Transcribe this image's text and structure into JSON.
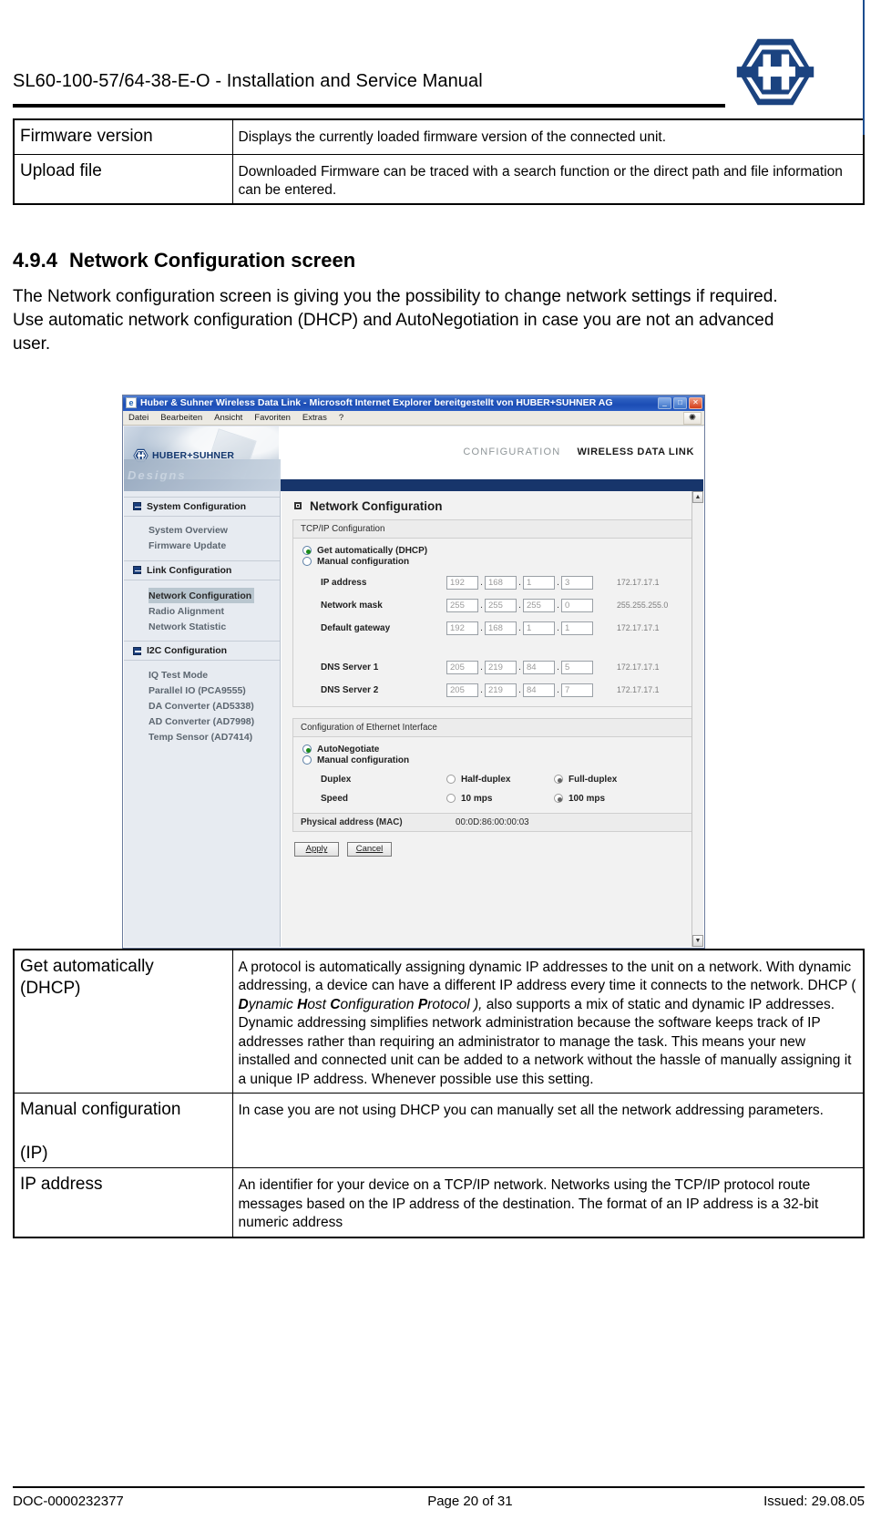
{
  "header": {
    "title": "SL60-100-57/64-38-E-O  -  Installation and Service Manual",
    "logo_name": "huber-suhner-hex-logo"
  },
  "top_table": {
    "rows": [
      {
        "term": "Firmware version",
        "desc": "Displays the currently loaded firmware version of the connected unit."
      },
      {
        "term": "Upload file",
        "desc": "Downloaded Firmware can be traced with a search function or the direct path and file information can be entered."
      }
    ]
  },
  "section": {
    "number": "4.9.4",
    "heading": "Network Configuration screen",
    "intro": "The Network configuration screen is giving you the possibility to change network settings if required. Use automatic network configuration (DHCP) and AutoNegotiation in case you are not an advanced user."
  },
  "screenshot": {
    "window": {
      "title": "Huber & Suhner Wireless Data Link - Microsoft Internet Explorer bereitgestellt von HUBER+SUHNER AG",
      "minimize": "_",
      "maximize": "□",
      "close": "✕"
    },
    "menu": [
      "Datei",
      "Bearbeiten",
      "Ansicht",
      "Favoriten",
      "Extras",
      "?"
    ],
    "brand": {
      "name": "HUBER+SUHNER",
      "watermark": "Designs",
      "configuration": "CONFIGURATION",
      "product": "WIRELESS DATA LINK"
    },
    "nav": {
      "groups": [
        {
          "label": "System Configuration",
          "items": [
            {
              "label": "System Overview",
              "active": false
            },
            {
              "label": "Firmware Update",
              "active": false
            }
          ]
        },
        {
          "label": "Link Configuration",
          "items": [
            {
              "label": "Network Configuration",
              "active": true
            },
            {
              "label": "Radio Alignment",
              "active": false
            },
            {
              "label": "Network Statistic",
              "active": false
            }
          ]
        },
        {
          "label": "I2C Configuration",
          "items": [
            {
              "label": "IQ Test Mode",
              "active": false
            },
            {
              "label": "Parallel IO (PCA9555)",
              "active": false
            },
            {
              "label": "DA Converter (AD5338)",
              "active": false
            },
            {
              "label": "AD Converter (AD7998)",
              "active": false
            },
            {
              "label": "Temp Sensor (AD7414)",
              "active": false
            }
          ]
        }
      ]
    },
    "panel": {
      "title": "Network Configuration",
      "tcpip": {
        "legend": "TCP/IP Configuration",
        "mode_auto": "Get automatically (DHCP)",
        "mode_manual": "Manual configuration",
        "mode_selected": "auto",
        "fields": [
          {
            "label": "IP address",
            "octets": [
              "192",
              "168",
              "1",
              "3"
            ],
            "current": "172.17.17.1"
          },
          {
            "label": "Network mask",
            "octets": [
              "255",
              "255",
              "255",
              "0"
            ],
            "current": "255.255.255.0"
          },
          {
            "label": "Default gateway",
            "octets": [
              "192",
              "168",
              "1",
              "1"
            ],
            "current": "172.17.17.1"
          },
          {
            "label": "DNS Server 1",
            "octets": [
              "205",
              "219",
              "84",
              "5"
            ],
            "current": "172.17.17.1"
          },
          {
            "label": "DNS Server 2",
            "octets": [
              "205",
              "219",
              "84",
              "7"
            ],
            "current": "172.17.17.1"
          }
        ]
      },
      "ethernet": {
        "legend": "Configuration of Ethernet Interface",
        "mode_auto": "AutoNegotiate",
        "mode_manual": "Manual configuration",
        "mode_selected": "auto",
        "duplex_label": "Duplex",
        "duplex_options": [
          {
            "label": "Half-duplex",
            "selected": false
          },
          {
            "label": "Full-duplex",
            "selected": true
          }
        ],
        "speed_label": "Speed",
        "speed_options": [
          {
            "label": "10 mps",
            "selected": false
          },
          {
            "label": "100 mps",
            "selected": true
          }
        ],
        "mac_label": "Physical address (MAC)",
        "mac_value": "00:0D:86:00:00:03"
      },
      "buttons": {
        "apply": "Apply",
        "cancel": "Cancel"
      },
      "scroll": {
        "up": "▲",
        "down": "▼"
      }
    }
  },
  "bottom_table": {
    "rows": [
      {
        "term": "Get automatically (DHCP)",
        "desc_parts": [
          {
            "text": "A protocol is automatically assigning dynamic IP addresses to the unit on a network. With dynamic addressing, a device can have a different IP address every time it connects to the network. DHCP ( ",
            "style": "normal"
          },
          {
            "text": "D",
            "style": "bold-italic"
          },
          {
            "text": "ynamic ",
            "style": "bold-italic-light"
          },
          {
            "text": "H",
            "style": "bold-italic"
          },
          {
            "text": "ost ",
            "style": "bold-italic-light"
          },
          {
            "text": "C",
            "style": "bold-italic"
          },
          {
            "text": "onfiguration ",
            "style": "bold-italic-light"
          },
          {
            "text": "P",
            "style": "bold-italic"
          },
          {
            "text": "rotocol ),",
            "style": "bold-italic-light"
          },
          {
            "text": " also supports a mix of static and dynamic IP addresses. Dynamic addressing simplifies network administration because the software keeps track of IP addresses rather than requiring an administrator to manage the task. This means your new installed and connected unit can be added to a network without the hassle of manually assigning it a unique IP address. Whenever possible use this setting.",
            "style": "normal"
          }
        ]
      },
      {
        "term": "Manual configuration (IP)",
        "term_line1": "Manual configuration",
        "term_line2": "(IP)",
        "desc": "In case you are not using DHCP you can manually set all the network addressing parameters."
      },
      {
        "term": "IP address",
        "desc": "An identifier for your device on a TCP/IP network. Networks using the TCP/IP protocol route messages based on the IP address of the destination. The format of an IP address is a 32-bit numeric address"
      }
    ]
  },
  "footer": {
    "doc_number": "DOC-0000232377",
    "page": "Page 20 of 31",
    "issued": "Issued: 29.08.05"
  },
  "colors": {
    "brand_blue": "#1b3f7d",
    "band_blue": "#17356b",
    "accent_line": "#1d4d8f"
  }
}
